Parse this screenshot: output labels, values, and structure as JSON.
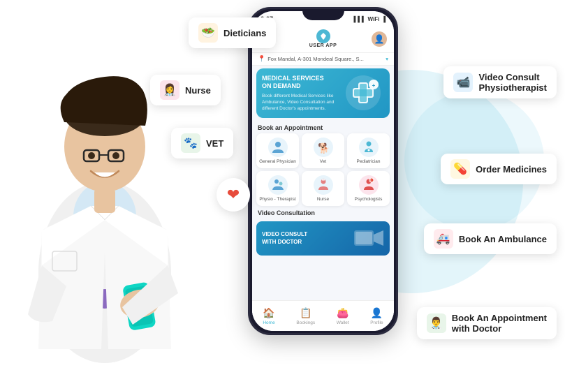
{
  "app": {
    "title": "USER APP",
    "status_bar": {
      "time": "6:07",
      "battery": "▐",
      "signal": "▌▌▌"
    },
    "location": "Fox Mandal, A-301 Mondeal Square., S...",
    "banner": {
      "title": "MEDICAL SERVICES\nON DEMAND",
      "subtitle": "Book different Medical Services like Ambulance, Video Consultation and different Doctor's appointments.",
      "icon": "🏥"
    },
    "book_appointment": {
      "section_title": "Book an Appointment",
      "items": [
        {
          "label": "General Physician",
          "icon": "👨‍⚕️"
        },
        {
          "label": "Vet",
          "icon": "🐾"
        },
        {
          "label": "Pediatrician",
          "icon": "👶"
        },
        {
          "label": "Physio - Therapist",
          "icon": "🤸"
        },
        {
          "label": "Nurse",
          "icon": "👩‍⚕️"
        },
        {
          "label": "Psychologists",
          "icon": "🧠"
        }
      ]
    },
    "video_consultation": {
      "section_title": "Video Consultation",
      "banner_title": "VIDEO CONSULT\nWITH DOCTOR",
      "banner_icon": "💻"
    },
    "nav": {
      "items": [
        {
          "label": "Home",
          "icon": "🏠",
          "active": true
        },
        {
          "label": "Bookings",
          "icon": "📋",
          "active": false
        },
        {
          "label": "Wallet",
          "icon": "👛",
          "active": false
        },
        {
          "label": "Profile",
          "icon": "👤",
          "active": false
        }
      ]
    }
  },
  "floating_bubbles": {
    "dieticians": {
      "label": "Dieticians",
      "icon": "🥗",
      "position": "top-left"
    },
    "nurse": {
      "label": "Nurse",
      "icon": "👩‍⚕️",
      "position": "left"
    },
    "vet": {
      "label": "VET",
      "icon": "🐾",
      "position": "left"
    },
    "video_consult": {
      "label": "Video Consult\nPhysiotherapist",
      "icon": "📹",
      "position": "right-top"
    },
    "order_medicines": {
      "label": "Order Medicines",
      "icon": "💊",
      "position": "right-mid"
    },
    "ambulance": {
      "label": "Book An Ambulance",
      "icon": "🚑",
      "position": "right-mid2"
    },
    "book_doctor": {
      "label": "Book An Appointment\nwith Doctor",
      "icon": "👨‍⚕️",
      "position": "right-bottom"
    }
  },
  "heart_icon": "❤️",
  "colors": {
    "primary": "#3db8d4",
    "secondary": "#2196c4",
    "accent": "#e74c3c",
    "bg": "#f5f7fb"
  }
}
